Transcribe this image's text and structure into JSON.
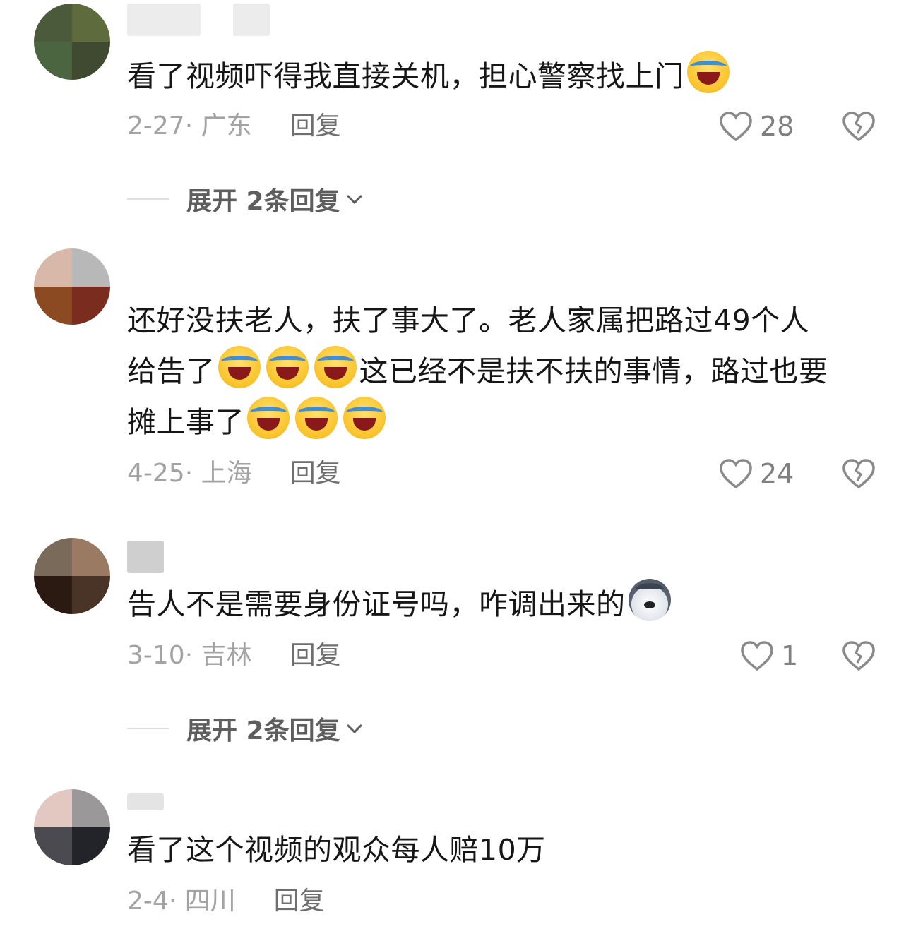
{
  "comments": [
    {
      "text_parts": [
        "看了视频吓得我直接关机，担心警察找上门"
      ],
      "emoji_after": [
        "laughing-crying-emoji"
      ],
      "date": "2-27",
      "location": "广东",
      "reply_label": "回复",
      "likes": "28",
      "expand_label": "展开 2条回复"
    },
    {
      "text_line1": "还好没扶老人，扶了事大了。老人家属把路过49个人",
      "text_line2_a": "给告了",
      "text_line2_b": "这已经不是扶不扶的事情，路过也要",
      "text_line3": "摊上事了",
      "date": "4-25",
      "location": "上海",
      "reply_label": "回复",
      "likes": "24"
    },
    {
      "text": "告人不是需要身份证号吗，咋调出来的",
      "emoji_after": [
        "husky-dog-emoji"
      ],
      "date": "3-10",
      "location": "吉林",
      "reply_label": "回复",
      "likes": "1",
      "expand_label": "展开 2条回复"
    },
    {
      "text": "看了这个视频的观众每人赔10万",
      "date": "2-4",
      "location": "四川",
      "reply_label": "回复"
    }
  ]
}
